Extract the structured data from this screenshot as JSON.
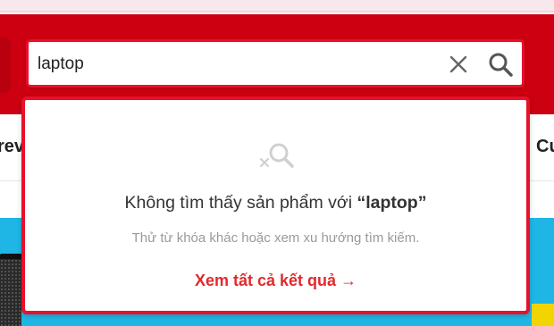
{
  "search": {
    "value": "laptop",
    "clear_icon": "close-icon",
    "submit_icon": "search-icon"
  },
  "categories": {
    "left_partial": "rev",
    "right_partial": "Cu"
  },
  "empty_state": {
    "icon": "no-results-search-icon",
    "title_prefix": "Không tìm thấy sản phẩm với ",
    "title_keyword": "“laptop”",
    "hint": "Thử từ khóa khác hoặc xem xu hướng tìm kiếm.",
    "see_all": "Xem tất cả kết quả →"
  },
  "colors": {
    "brand_red": "#cc0010",
    "accent_red": "#e8102a",
    "link_red": "#e0292d"
  }
}
